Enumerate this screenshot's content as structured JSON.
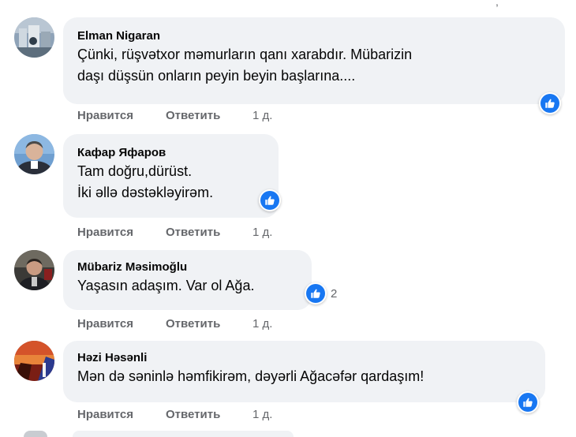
{
  "colors": {
    "bubble": "#f0f2f5",
    "meta_text": "#65676b",
    "like_blue": "#1877f2"
  },
  "comments": [
    {
      "author": "Elman Nigaran",
      "lines": [
        "Çünki, rüşvətxor məmurların qanı xarabdır. Mübarizin",
        "daşı düşsün onların peyin beyin başlarına...."
      ],
      "reaction_icon": "thumbs-up-icon",
      "reaction_count": "",
      "like_label": "Нравится",
      "reply_label": "Ответить",
      "time": "1 д."
    },
    {
      "author": "Кафар Яфаров",
      "lines": [
        "Tam doğru,dürüst.",
        "İki əllə dəstəkləyirəm."
      ],
      "reaction_icon": "thumbs-up-icon",
      "reaction_count": "",
      "like_label": "Нравится",
      "reply_label": "Ответить",
      "time": "1 д."
    },
    {
      "author": "Mübariz Məsimoğlu",
      "lines": [
        "Yaşasın adaşım. Var ol Ağa."
      ],
      "reaction_icon": "thumbs-up-icon",
      "reaction_count": "2",
      "like_label": "Нравится",
      "reply_label": "Ответить",
      "time": "1 д."
    },
    {
      "author": "Həzi Həsənli",
      "lines": [
        "Mən də səninlə həmfikirəm, dəyərli Ağacəfər qardaşım!"
      ],
      "reaction_icon": "thumbs-up-icon",
      "reaction_count": "",
      "like_label": "Нравится",
      "reply_label": "Ответить",
      "time": "1 д."
    }
  ]
}
